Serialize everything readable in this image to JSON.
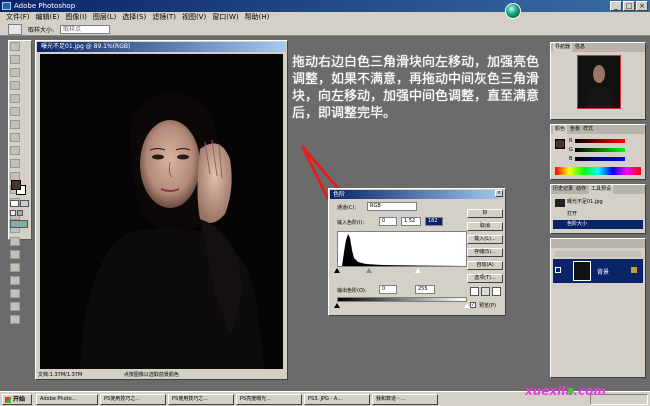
{
  "window": {
    "title": "Adobe Photoshop",
    "buttons": [
      "_",
      "□",
      "×"
    ]
  },
  "menu": [
    "文件(F)",
    "编辑(E)",
    "图像(I)",
    "图层(L)",
    "选择(S)",
    "滤镜(T)",
    "视图(V)",
    "窗口(W)",
    "帮助(H)"
  ],
  "options": {
    "label": "取样大小:",
    "select_value": "取样点"
  },
  "document": {
    "title": "曝光不足01.jpg @ 89.1%(RGB)",
    "status": "文档:1.37M/1.37M",
    "hint": "点按图像以选取前景颜色"
  },
  "instruction": "拖动右边白色三角滑块向左移动，加强亮色调整，如果不满意，再拖动中间灰色三角滑块，向左移动，加强中间色调整，直至满意后，即调整完毕。",
  "levels": {
    "title": "色阶",
    "channel_label": "通道(C):",
    "channel_value": "RGB",
    "input_label": "输入色阶(I):",
    "input_black": "0",
    "input_gamma": "1.52",
    "input_white": "182",
    "output_label": "输出色阶(O):",
    "output_black": "0",
    "output_white": "255",
    "buttons": [
      "好",
      "取消",
      "载入(L)...",
      "存储(S)...",
      "自动(A)",
      "选项(T)..."
    ],
    "preview_label": "预览(P)"
  },
  "navigator": {
    "tabs": [
      "导航器",
      "信息"
    ]
  },
  "color_panel": {
    "tabs": [
      "颜色",
      "色板",
      "样式"
    ],
    "channels": [
      "R",
      "G",
      "B"
    ]
  },
  "history": {
    "tabs": [
      "历史记录",
      "动作",
      "工具预设"
    ],
    "snapshot": "曝光不足01.jpg",
    "items": [
      "打开",
      "色阶大小"
    ]
  },
  "layers": {
    "layer_name": "背景"
  },
  "taskbar": {
    "start": "开始",
    "tasks": [
      "Adobe Photo...",
      "PS使用技巧之...",
      "PS使用技巧之...",
      "PS亮度曝光...",
      "PS3. JPG - A...",
      "我和数道 - ..."
    ]
  },
  "watermark": "xuexila.com",
  "colors": {
    "accent": "#0a246a",
    "arrow": "#e02020",
    "foreground": "#4a3520"
  }
}
